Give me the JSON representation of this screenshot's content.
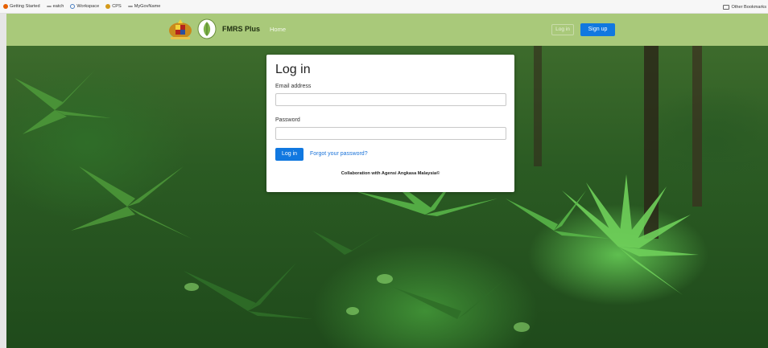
{
  "bookmarks": {
    "items": [
      {
        "label": "Getting Started",
        "icon": "firefox-icon",
        "color": "#e66000"
      },
      {
        "label": "eatch",
        "icon": "link-icon",
        "color": "#777777"
      },
      {
        "label": "Workspace",
        "icon": "globe-icon",
        "color": "#4a7fc1"
      },
      {
        "label": "CPS",
        "icon": "crest-icon",
        "color": "#d49a1a"
      },
      {
        "label": "MyGovName",
        "icon": "link-icon",
        "color": "#777777"
      }
    ],
    "other_label": "Other Bookmarks"
  },
  "navbar": {
    "brand": "FMRS Plus",
    "home": "Home",
    "login": "Log in",
    "signup": "Sign up",
    "bg_color": "#a9c97a",
    "accent": "#1178e0"
  },
  "login": {
    "title": "Log in",
    "email_label": "Email address",
    "email_value": "",
    "password_label": "Password",
    "password_value": "",
    "submit": "Log in",
    "forgot": "Forgot your password?",
    "collab": "Collaboration with Agensi Angkasa Malaysia©"
  }
}
